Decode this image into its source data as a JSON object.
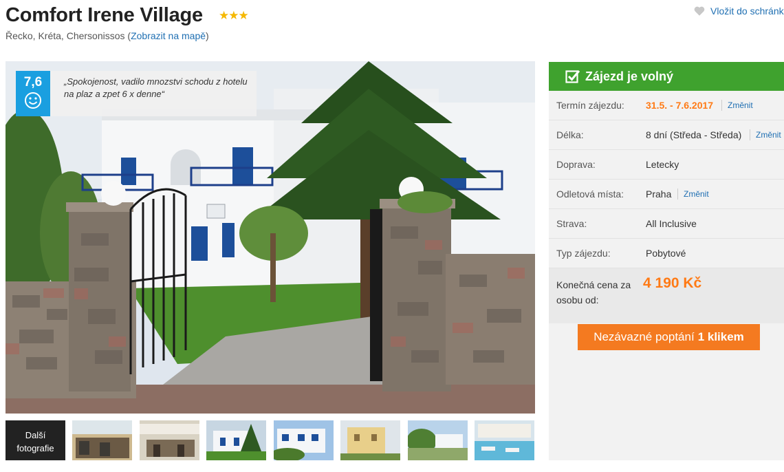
{
  "hotel": {
    "name": "Comfort Irene Village",
    "stars": "★★★",
    "location": "Řecko, Kréta, Chersonissos (",
    "map_link": "Zobrazit na mapě",
    "location_close": ")"
  },
  "header": {
    "favorite_label": "Vložit do schránk"
  },
  "review": {
    "score": "7,6",
    "quote": "„Spokojenost, vadilo mnozstvi schodu z hotelu na plaz a zpet 6 x denne“"
  },
  "gallery": {
    "more_label": "Další fotografie",
    "thumb_count": 7
  },
  "booking": {
    "status": "Zájezd je volný",
    "rows": [
      {
        "label": "Termín zájezdu:",
        "value": "31.5. - 7.6.2017",
        "change": "Změnit"
      },
      {
        "label": "Délka:",
        "value": "8 dní (Středa - Středa)",
        "change": "Změnit"
      },
      {
        "label": "Doprava:",
        "value": "Letecky"
      },
      {
        "label": "Odletová místa:",
        "value": "Praha",
        "change": "Změnit"
      },
      {
        "label": "Strava:",
        "value": "All Inclusive"
      },
      {
        "label": "Typ zájezdu:",
        "value": "Pobytové"
      }
    ],
    "price_label": "Konečná cena za osobu od:",
    "price": "4 190 Kč",
    "inquiry_label": "Nezávazné poptání",
    "inquiry_bold": "1 klikem"
  },
  "colors": {
    "accent_orange": "#ff7a15",
    "available_green": "#3fa22e",
    "rating_blue": "#1a9fe0",
    "link_blue": "#1f6fb2"
  }
}
